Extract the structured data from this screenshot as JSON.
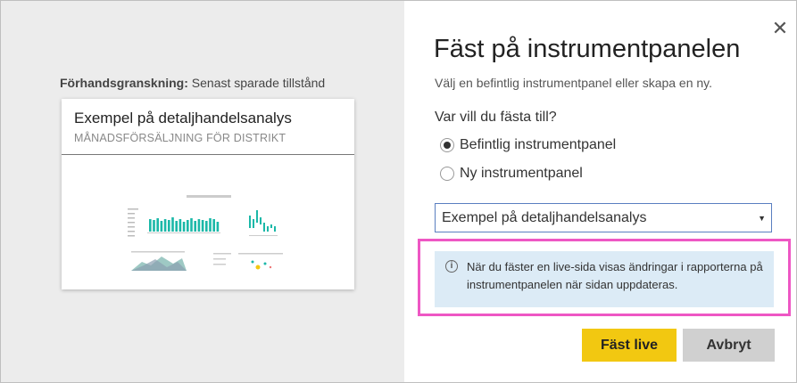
{
  "preview": {
    "caption_bold": "Förhandsgranskning:",
    "caption_rest": " Senast sparade tillstånd",
    "tile_title": "Exempel på detaljhandelsanalys",
    "tile_subtitle": "MÅNADSFÖRSÄLJNING FÖR DISTRIKT"
  },
  "dialog": {
    "title": "Fäst på instrumentpanelen",
    "subtitle": "Välj en befintlig instrumentpanel eller skapa en ny.",
    "question": "Var vill du fästa till?",
    "options": [
      {
        "label": "Befintlig instrumentpanel",
        "checked": true
      },
      {
        "label": "Ny instrumentpanel",
        "checked": false
      }
    ],
    "select_value": "Exempel på detaljhandelsanalys",
    "info_text": "När du fäster en live-sida visas ändringar i rapporterna på instrumentpanelen när sidan uppdateras.",
    "primary_button": "Fäst live",
    "secondary_button": "Avbryt"
  },
  "icons": {
    "close": "close-icon",
    "info": "info-icon",
    "dropdown": "chevron-down-icon"
  },
  "colors": {
    "primary_button": "#f2c811",
    "highlight": "#ee57c4",
    "info_background": "#dcebf6",
    "chart_accent": "#1bb8a8"
  }
}
